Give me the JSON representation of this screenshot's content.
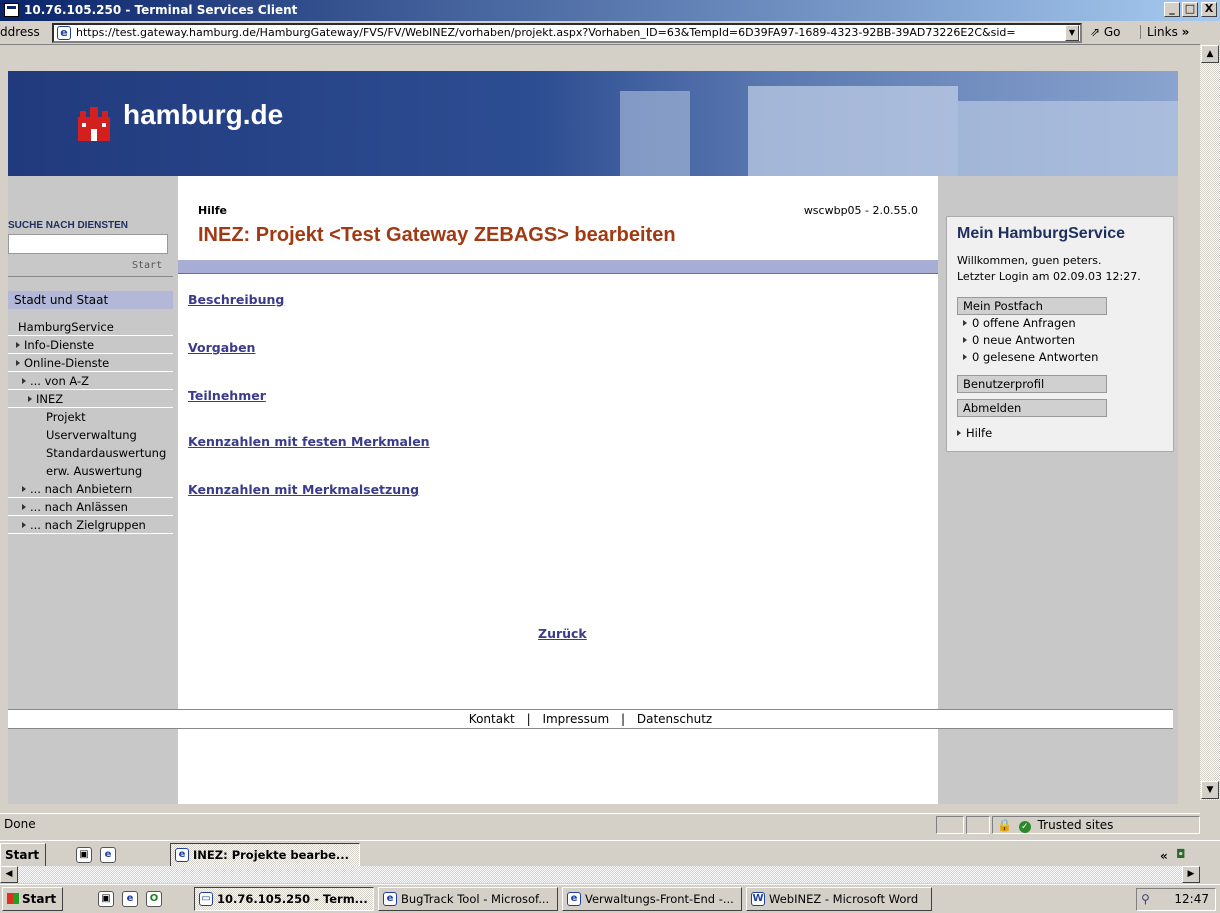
{
  "window": {
    "title": "10.76.105.250 - Terminal Services Client",
    "min": "_",
    "max": "□",
    "close": "X"
  },
  "browser": {
    "address_label": "ddress",
    "url": "https://test.gateway.hamburg.de/HamburgGateway/FVS/FV/WebINEZ/vorhaben/projekt.aspx?Vorhaben_ID=63&TempId=6D39FA97-1689-4323-92BB-39AD73226E2C&sid=",
    "go_label": "Go",
    "links_label": "Links"
  },
  "site": {
    "logo_text": "hamburg.de"
  },
  "left_nav": {
    "search_heading": "SUCHE NACH DIENSTEN",
    "search_value": "",
    "search_button": "Start",
    "section_heading": "Stadt und Staat",
    "items": [
      {
        "label": "HamburgService",
        "arrow": false,
        "indent": 0
      },
      {
        "label": "Info-Dienste",
        "arrow": true,
        "indent": 0
      },
      {
        "label": "Online-Dienste",
        "arrow": true,
        "indent": 0
      },
      {
        "label": "... von A-Z",
        "arrow": true,
        "indent": 1
      },
      {
        "label": "INEZ",
        "arrow": true,
        "indent": 2
      }
    ],
    "subitems": [
      "Projekt",
      "Userverwaltung",
      "Standardauswertung",
      "erw. Auswertung"
    ],
    "more_items": [
      {
        "label": "... nach Anbietern"
      },
      {
        "label": "... nach Anlässen"
      },
      {
        "label": "... nach Zielgruppen"
      }
    ]
  },
  "main": {
    "help_link": "Hilfe",
    "version": "wscwbp05 - 2.0.55.0",
    "page_title": "INEZ: Projekt <Test Gateway ZEBAGS> bearbeiten",
    "links": [
      "Beschreibung",
      "Vorgaben",
      "Teilnehmer",
      "Kennzahlen mit festen Merkmalen",
      "Kennzahlen mit Merkmalsetzung"
    ],
    "back_link": "Zurück"
  },
  "service_box": {
    "title": "Mein HamburgService",
    "welcome_line1": "Willkommen, guen peters.",
    "welcome_line2": "Letzter Login am 02.09.03 12:27.",
    "postfach_button": "Mein Postfach",
    "postfach_items": [
      "0 offene Anfragen",
      "0 neue Antworten",
      "0 gelesene Antworten"
    ],
    "profile_button": "Benutzerprofil",
    "logout_button": "Abmelden",
    "help_item": "Hilfe"
  },
  "footer": {
    "links": [
      "Kontakt",
      "Impressum",
      "Datenschutz"
    ],
    "separator": "|"
  },
  "status": {
    "text": "Done",
    "zone": "Trusted sites"
  },
  "inner_taskbar": {
    "start": "Start",
    "task": "INEZ: Projekte bearbe...",
    "chevron": "«"
  },
  "outer_taskbar": {
    "start": "Start",
    "tasks": [
      "10.76.105.250 - Term...",
      "BugTrack Tool - Microsof...",
      "Verwaltungs-Front-End -...",
      "WebINEZ - Microsoft Word"
    ],
    "clock": "12:47"
  }
}
